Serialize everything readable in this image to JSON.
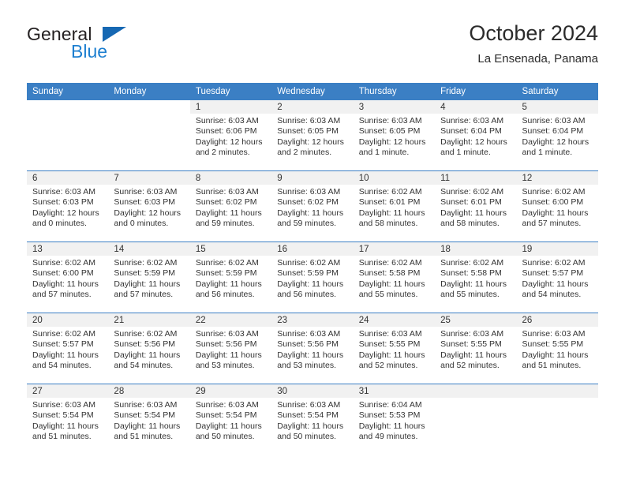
{
  "brand": {
    "name_part1": "General",
    "name_part2": "Blue",
    "triangle_color": "#1668b3",
    "blue_color": "#1d7fd0"
  },
  "header": {
    "title": "October 2024",
    "subtitle": "La Ensenada, Panama"
  },
  "colors": {
    "header_blue": "#3b7fc4",
    "daynum_band": "#f1f1f1",
    "text": "#333333"
  },
  "weekday_headers": [
    "Sunday",
    "Monday",
    "Tuesday",
    "Wednesday",
    "Thursday",
    "Friday",
    "Saturday"
  ],
  "weeks": [
    [
      {
        "day": "",
        "blank": true
      },
      {
        "day": "",
        "blank": true
      },
      {
        "day": "1",
        "sunrise": "Sunrise: 6:03 AM",
        "sunset": "Sunset: 6:06 PM",
        "daylight": "Daylight: 12 hours and 2 minutes."
      },
      {
        "day": "2",
        "sunrise": "Sunrise: 6:03 AM",
        "sunset": "Sunset: 6:05 PM",
        "daylight": "Daylight: 12 hours and 2 minutes."
      },
      {
        "day": "3",
        "sunrise": "Sunrise: 6:03 AM",
        "sunset": "Sunset: 6:05 PM",
        "daylight": "Daylight: 12 hours and 1 minute."
      },
      {
        "day": "4",
        "sunrise": "Sunrise: 6:03 AM",
        "sunset": "Sunset: 6:04 PM",
        "daylight": "Daylight: 12 hours and 1 minute."
      },
      {
        "day": "5",
        "sunrise": "Sunrise: 6:03 AM",
        "sunset": "Sunset: 6:04 PM",
        "daylight": "Daylight: 12 hours and 1 minute."
      }
    ],
    [
      {
        "day": "6",
        "sunrise": "Sunrise: 6:03 AM",
        "sunset": "Sunset: 6:03 PM",
        "daylight": "Daylight: 12 hours and 0 minutes."
      },
      {
        "day": "7",
        "sunrise": "Sunrise: 6:03 AM",
        "sunset": "Sunset: 6:03 PM",
        "daylight": "Daylight: 12 hours and 0 minutes."
      },
      {
        "day": "8",
        "sunrise": "Sunrise: 6:03 AM",
        "sunset": "Sunset: 6:02 PM",
        "daylight": "Daylight: 11 hours and 59 minutes."
      },
      {
        "day": "9",
        "sunrise": "Sunrise: 6:03 AM",
        "sunset": "Sunset: 6:02 PM",
        "daylight": "Daylight: 11 hours and 59 minutes."
      },
      {
        "day": "10",
        "sunrise": "Sunrise: 6:02 AM",
        "sunset": "Sunset: 6:01 PM",
        "daylight": "Daylight: 11 hours and 58 minutes."
      },
      {
        "day": "11",
        "sunrise": "Sunrise: 6:02 AM",
        "sunset": "Sunset: 6:01 PM",
        "daylight": "Daylight: 11 hours and 58 minutes."
      },
      {
        "day": "12",
        "sunrise": "Sunrise: 6:02 AM",
        "sunset": "Sunset: 6:00 PM",
        "daylight": "Daylight: 11 hours and 57 minutes."
      }
    ],
    [
      {
        "day": "13",
        "sunrise": "Sunrise: 6:02 AM",
        "sunset": "Sunset: 6:00 PM",
        "daylight": "Daylight: 11 hours and 57 minutes."
      },
      {
        "day": "14",
        "sunrise": "Sunrise: 6:02 AM",
        "sunset": "Sunset: 5:59 PM",
        "daylight": "Daylight: 11 hours and 57 minutes."
      },
      {
        "day": "15",
        "sunrise": "Sunrise: 6:02 AM",
        "sunset": "Sunset: 5:59 PM",
        "daylight": "Daylight: 11 hours and 56 minutes."
      },
      {
        "day": "16",
        "sunrise": "Sunrise: 6:02 AM",
        "sunset": "Sunset: 5:59 PM",
        "daylight": "Daylight: 11 hours and 56 minutes."
      },
      {
        "day": "17",
        "sunrise": "Sunrise: 6:02 AM",
        "sunset": "Sunset: 5:58 PM",
        "daylight": "Daylight: 11 hours and 55 minutes."
      },
      {
        "day": "18",
        "sunrise": "Sunrise: 6:02 AM",
        "sunset": "Sunset: 5:58 PM",
        "daylight": "Daylight: 11 hours and 55 minutes."
      },
      {
        "day": "19",
        "sunrise": "Sunrise: 6:02 AM",
        "sunset": "Sunset: 5:57 PM",
        "daylight": "Daylight: 11 hours and 54 minutes."
      }
    ],
    [
      {
        "day": "20",
        "sunrise": "Sunrise: 6:02 AM",
        "sunset": "Sunset: 5:57 PM",
        "daylight": "Daylight: 11 hours and 54 minutes."
      },
      {
        "day": "21",
        "sunrise": "Sunrise: 6:02 AM",
        "sunset": "Sunset: 5:56 PM",
        "daylight": "Daylight: 11 hours and 54 minutes."
      },
      {
        "day": "22",
        "sunrise": "Sunrise: 6:03 AM",
        "sunset": "Sunset: 5:56 PM",
        "daylight": "Daylight: 11 hours and 53 minutes."
      },
      {
        "day": "23",
        "sunrise": "Sunrise: 6:03 AM",
        "sunset": "Sunset: 5:56 PM",
        "daylight": "Daylight: 11 hours and 53 minutes."
      },
      {
        "day": "24",
        "sunrise": "Sunrise: 6:03 AM",
        "sunset": "Sunset: 5:55 PM",
        "daylight": "Daylight: 11 hours and 52 minutes."
      },
      {
        "day": "25",
        "sunrise": "Sunrise: 6:03 AM",
        "sunset": "Sunset: 5:55 PM",
        "daylight": "Daylight: 11 hours and 52 minutes."
      },
      {
        "day": "26",
        "sunrise": "Sunrise: 6:03 AM",
        "sunset": "Sunset: 5:55 PM",
        "daylight": "Daylight: 11 hours and 51 minutes."
      }
    ],
    [
      {
        "day": "27",
        "sunrise": "Sunrise: 6:03 AM",
        "sunset": "Sunset: 5:54 PM",
        "daylight": "Daylight: 11 hours and 51 minutes."
      },
      {
        "day": "28",
        "sunrise": "Sunrise: 6:03 AM",
        "sunset": "Sunset: 5:54 PM",
        "daylight": "Daylight: 11 hours and 51 minutes."
      },
      {
        "day": "29",
        "sunrise": "Sunrise: 6:03 AM",
        "sunset": "Sunset: 5:54 PM",
        "daylight": "Daylight: 11 hours and 50 minutes."
      },
      {
        "day": "30",
        "sunrise": "Sunrise: 6:03 AM",
        "sunset": "Sunset: 5:54 PM",
        "daylight": "Daylight: 11 hours and 50 minutes."
      },
      {
        "day": "31",
        "sunrise": "Sunrise: 6:04 AM",
        "sunset": "Sunset: 5:53 PM",
        "daylight": "Daylight: 11 hours and 49 minutes."
      },
      {
        "day": "",
        "empty": true
      },
      {
        "day": "",
        "empty": true
      }
    ]
  ]
}
